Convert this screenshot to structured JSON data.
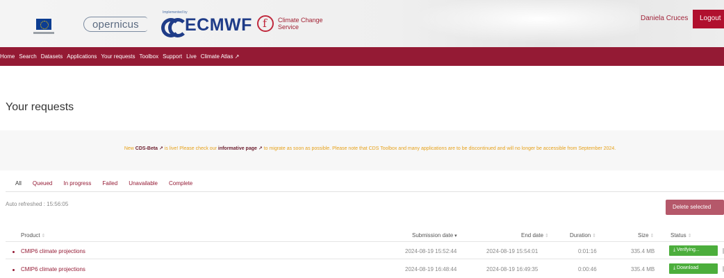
{
  "header": {
    "brand_copernicus": "opernicus",
    "brand_ecmwf_pre": "Implemented by",
    "brand_ecmwf": "ECMWF",
    "brand_c3s_line1": "Climate Change",
    "brand_c3s_line2": "Service",
    "user_name": "Daniela Cruces",
    "logout_label": "Logout"
  },
  "nav": {
    "items": [
      "Home",
      "Search",
      "Datasets",
      "Applications",
      "Your requests",
      "Toolbox",
      "Support",
      "Live",
      "Climate Atlas ↗"
    ]
  },
  "page": {
    "title": "Your requests"
  },
  "notice": {
    "prefix": "New ",
    "cds_beta": "CDS-Beta ↗",
    "middle": " is live! Please check our ",
    "informative_page": "informative page ↗",
    "suffix": " to migrate as soon as possible. Please note that CDS Toolbox and many applications are to be discontinued and will no longer be accessible from September 2024."
  },
  "tabs": [
    "All",
    "Queued",
    "In progress",
    "Failed",
    "Unavailable",
    "Complete"
  ],
  "autorefresh": "Auto refreshed : 15:56:05",
  "delete_selected_label": "Delete selected",
  "table": {
    "headers": {
      "product": "Product",
      "submission_date": "Submission date",
      "end_date": "End date",
      "duration": "Duration",
      "size": "Size",
      "status": "Status"
    },
    "rows": [
      {
        "product": "CMIP6 climate projections",
        "submission_date": "2024-08-19 15:52:44",
        "end_date": "2024-08-19 15:54:01",
        "duration": "0:01:16",
        "size": "335.4 MB",
        "status": "⤓ Verifying..."
      },
      {
        "product": "CMIP6 climate projections",
        "submission_date": "2024-08-19 16:48:44",
        "end_date": "2024-08-19 16:49:35",
        "duration": "0:00:46",
        "size": "335.4 MB",
        "status": "⤓ Download"
      }
    ]
  },
  "colors": {
    "nav_bg": "#941a34",
    "logout_bg": "#b0102e",
    "status_green": "#4cae3c",
    "notice_orange": "#e6a11a"
  }
}
